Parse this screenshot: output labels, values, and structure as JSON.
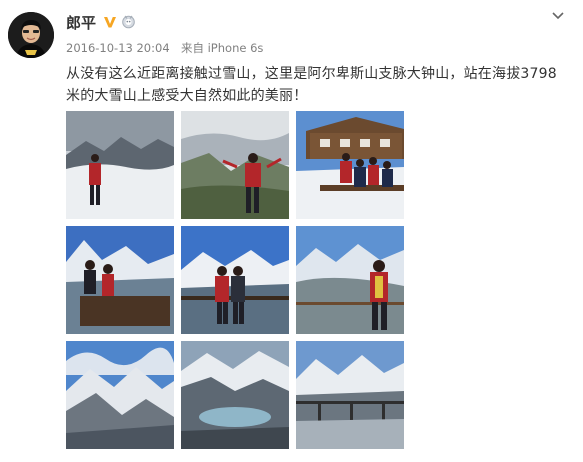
{
  "post": {
    "username": "郎平",
    "badges": [
      "v-verified-icon",
      "medal-icon"
    ],
    "timestamp": "2016-10-13 20:04",
    "source_prefix": "来自",
    "source_device": "iPhone 6s",
    "text": "从没有这么近距离接触过雪山，这里是阿尔卑斯山支脉大钟山，站在海拔3798米的大雪山上感受大自然如此的美丽！"
  },
  "photos": [
    {
      "name": "photo-1",
      "description_icon": "snow-mountain-person-red-jacket"
    },
    {
      "name": "photo-2",
      "description_icon": "person-arms-spread-snow-valley"
    },
    {
      "name": "photo-3",
      "description_icon": "group-at-wooden-lodge"
    },
    {
      "name": "photo-4",
      "description_icon": "two-people-on-bench-glacier"
    },
    {
      "name": "photo-5",
      "description_icon": "couple-on-platform"
    },
    {
      "name": "photo-6",
      "description_icon": "person-at-railing-glacier"
    },
    {
      "name": "photo-7",
      "description_icon": "snowy-peaks-blue-sky"
    },
    {
      "name": "photo-8",
      "description_icon": "glacier-lake-valley"
    },
    {
      "name": "photo-9",
      "description_icon": "mountain-panorama-railing"
    }
  ],
  "colors": {
    "username": "#333333",
    "meta": "#808080",
    "verified_badge": "#f6a623",
    "text": "#333333"
  }
}
